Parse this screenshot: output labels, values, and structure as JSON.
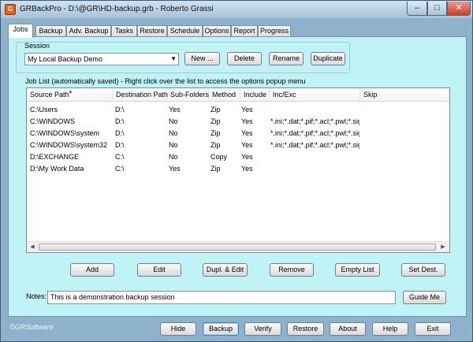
{
  "window": {
    "app_name": "GRBackPro",
    "title": "GRBackPro - D:\\@GR\\HD-backup.grb - Roberto Grassi",
    "icon_letter": "G"
  },
  "window_controls": {
    "minimize": "–",
    "maximize": "□",
    "close": "✕"
  },
  "tabs": [
    "Jobs",
    "Backup",
    "Adv. Backup",
    "Tasks",
    "Restore",
    "Schedule",
    "Options",
    "Report",
    "Progress"
  ],
  "session": {
    "group_label": "Session",
    "selected": "My Local Backup Demo",
    "buttons": {
      "new": "New ...",
      "delete": "Delete",
      "rename": "Rename",
      "duplicate": "Duplicate"
    }
  },
  "job_list": {
    "caption": "Job List (automatically saved) - Right click over the list to access the options popup menu",
    "columns": [
      "Source Path",
      "Destination Path",
      "Sub-Folders",
      "Method",
      "Include",
      "Inc/Exc",
      "Skip"
    ],
    "rows": [
      [
        "C:\\Users",
        "D:\\",
        "Yes",
        "Zip",
        "Yes",
        "",
        ""
      ],
      [
        "C:\\WINDOWS",
        "D:\\",
        "No",
        "Zip",
        "Yes",
        "*.ini;*.dat;*.pif;*.acl;*.pwl;*.sig",
        ""
      ],
      [
        "C:\\WINDOWS\\system",
        "D:\\",
        "No",
        "Zip",
        "Yes",
        "*.ini;*.dat;*.pif;*.acl;*.pwl;*.sig",
        ""
      ],
      [
        "C:\\WINDOWS\\system32",
        "D:\\",
        "No",
        "Zip",
        "Yes",
        "*.ini;*.dat;*.pif;*.acl;*.pwl;*.sig",
        ""
      ],
      [
        "D:\\EXCHANGE",
        "C:\\",
        "No",
        "Copy",
        "Yes",
        "",
        ""
      ],
      [
        "D:\\My Work Data",
        "C:\\",
        "Yes",
        "Zip",
        "Yes",
        "",
        ""
      ]
    ]
  },
  "list_buttons": {
    "add": "Add",
    "edit": "Edit",
    "dupl_edit": "Dupl. & Edit",
    "remove": "Remove",
    "empty_list": "Empty List",
    "set_dest": "Set Dest."
  },
  "notes": {
    "label": "Notes:",
    "value": "This is a demonstration backup session",
    "guide_button": "Guide Me"
  },
  "footer": {
    "logo": "©GRSoftware",
    "buttons": {
      "hide": "Hide",
      "backup": "Backup",
      "verify": "Verify",
      "restore": "Restore",
      "about": "About",
      "help": "Help",
      "exit": "Exit"
    }
  }
}
